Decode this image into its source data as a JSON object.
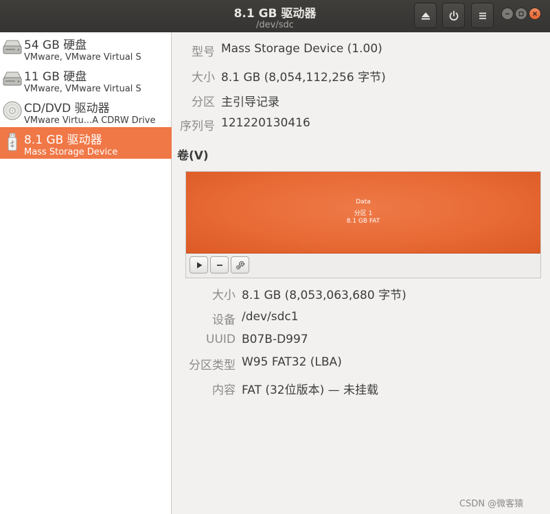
{
  "window": {
    "title": "8.1 GB 驱动器",
    "subtitle": "/dev/sdc"
  },
  "header_buttons": {
    "eject": "eject-icon",
    "power": "power-icon",
    "menu": "menu-icon"
  },
  "drives": [
    {
      "name": "54 GB 硬盘",
      "detail": "VMware, VMware Virtual S",
      "icon": "hard-disk-icon"
    },
    {
      "name": "11 GB 硬盘",
      "detail": "VMware, VMware Virtual S",
      "icon": "hard-disk-icon"
    },
    {
      "name": "CD/DVD 驱动器",
      "detail": "VMware Virtu...A CDRW Drive",
      "icon": "optical-disc-icon"
    },
    {
      "name": "8.1 GB 驱动器",
      "detail": "Mass Storage Device",
      "icon": "usb-drive-icon",
      "selected": true
    }
  ],
  "drive_info": {
    "model_label": "型号",
    "model_value": "Mass Storage Device (1.00)",
    "size_label": "大小",
    "size_value": "8.1 GB (8,054,112,256 字节)",
    "partitioning_label": "分区",
    "partitioning_value": "主引导记录",
    "serial_label": "序列号",
    "serial_value": "121220130416"
  },
  "volumes": {
    "title": "卷(V)",
    "partition": {
      "line1": "Data",
      "line2": "分区 1",
      "line3": "8.1 GB FAT"
    },
    "tools": {
      "play": "play-icon",
      "remove": "minus-icon",
      "settings": "gears-icon"
    }
  },
  "partition_info": {
    "size_label": "大小",
    "size_value": "8.1 GB (8,053,063,680 字节)",
    "device_label": "设备",
    "device_value": "/dev/sdc1",
    "uuid_label": "UUID",
    "uuid_value": "B07B-D997",
    "type_label": "分区类型",
    "type_value": "W95 FAT32 (LBA)",
    "contents_label": "内容",
    "contents_value": "FAT (32位版本) — 未挂载"
  },
  "watermark": "CSDN @微客猿",
  "colors": {
    "accent": "#f07746",
    "headerbar": "#3a3937",
    "close": "#e8643a"
  }
}
